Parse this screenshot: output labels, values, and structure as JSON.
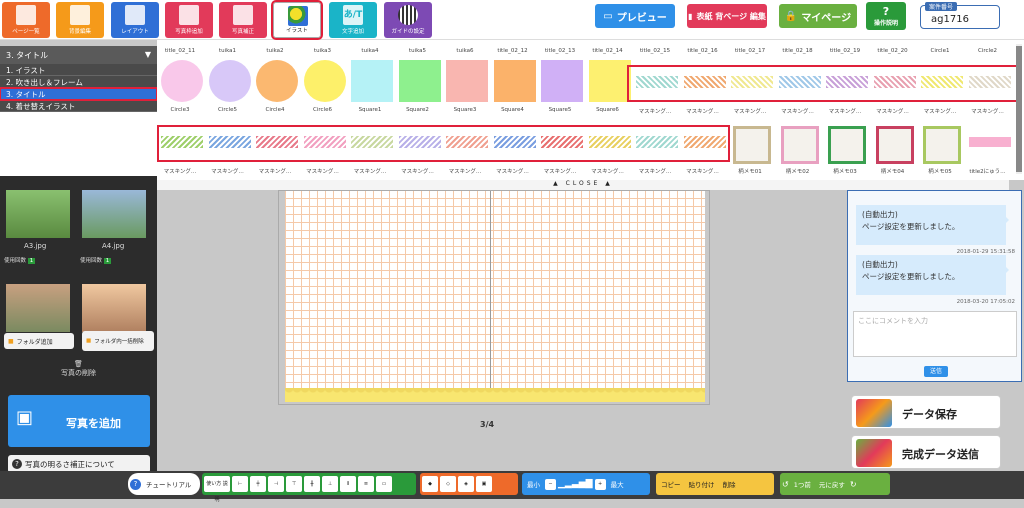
{
  "toolbar": {
    "buttons": [
      "ページ一覧",
      "背景編集",
      "レイアウト",
      "写真枠追加",
      "写真補正",
      "イラスト",
      "文字追加",
      "ガイドの設定"
    ],
    "right": {
      "preview": "プレビュー",
      "cover_edit": "表紙 背ページ 編集",
      "mypage": "マイページ",
      "help": "操作説明"
    },
    "case": {
      "label": "案件番号",
      "value": "ag1716"
    }
  },
  "category": {
    "selected": "3. タイトル",
    "items": [
      "1. イラスト",
      "2. 吹き出し＆フレーム",
      "3. タイトル",
      "4. 着せ替えイラスト"
    ]
  },
  "palette": {
    "row1_names": [
      "title_02_11",
      "tuika1",
      "tuika2",
      "tuika3",
      "tuika4",
      "tuika5",
      "tuika6",
      "title_02_12",
      "title_02_13",
      "title_02_14",
      "title_02_15",
      "title_02_16",
      "title_02_17",
      "title_02_18",
      "title_02_19",
      "title_02_20",
      "Circle1",
      "Circle2"
    ],
    "row2_names": [
      "Circle3",
      "Circle5",
      "Circle4",
      "Circle6",
      "Square1",
      "Square2",
      "Square3",
      "Square4",
      "Square5",
      "Square6",
      "マスキング…",
      "マスキング…",
      "マスキング…",
      "マスキング…",
      "マスキング…",
      "マスキング…",
      "マスキング…",
      "マスキング…"
    ],
    "row3_names": [
      "マスキング…",
      "マスキング…",
      "マスキング…",
      "マスキング…",
      "マスキング…",
      "マスキング…",
      "マスキング…",
      "マスキング…",
      "マスキング…",
      "マスキング…",
      "マスキング…",
      "マスキング…",
      "柄メモ01",
      "柄メモ02",
      "柄メモ03",
      "柄メモ04",
      "柄メモ05",
      "title2にゅう…"
    ],
    "close": "CLOSE",
    "colors": {
      "pink": "#f9c8ea",
      "lavender": "#d8c8f8",
      "orange": "#fbb870",
      "yellow": "#fdf06a",
      "ice": "#b5f2f6",
      "green": "#8ef08e",
      "salmon": "#f9b6b0",
      "peach": "#fbb26a",
      "violet": "#d0b0f6",
      "lemon": "#fdf070"
    }
  },
  "left_panel": {
    "photos": [
      {
        "name": "A3.jpg",
        "uses": "1"
      },
      {
        "name": "A4.jpg",
        "uses": "1"
      }
    ],
    "uses_label": "使用回数",
    "folder_add": "フォルダ追加",
    "folder_delete": "フォルダ内一括削除",
    "delete_photo": "写真の削除",
    "add_photo": "写真を追加",
    "brightness": "写真の明るさ補正について"
  },
  "page_indicator": "3/4",
  "chat": {
    "messages": [
      {
        "title": "(自動出力)",
        "text": "ページ設定を更新しました。",
        "time": "2018-01-29 15:31:58"
      },
      {
        "title": "(自動出力)",
        "text": "ページ設定を更新しました。",
        "time": "2018-03-20 17:05:02"
      }
    ],
    "placeholder": "ここにコメントを入力",
    "send": "送信"
  },
  "actions": {
    "save": "データ保存",
    "submit": "完成データ送信"
  },
  "bottom": {
    "tutorial": "チュートリアル",
    "usage": "使い方 説明",
    "min": "最小",
    "max": "最大",
    "copy": "コピー",
    "paste": "貼り付け",
    "delete": "削除",
    "undo": "1つ前",
    "redo": "元に戻す"
  }
}
